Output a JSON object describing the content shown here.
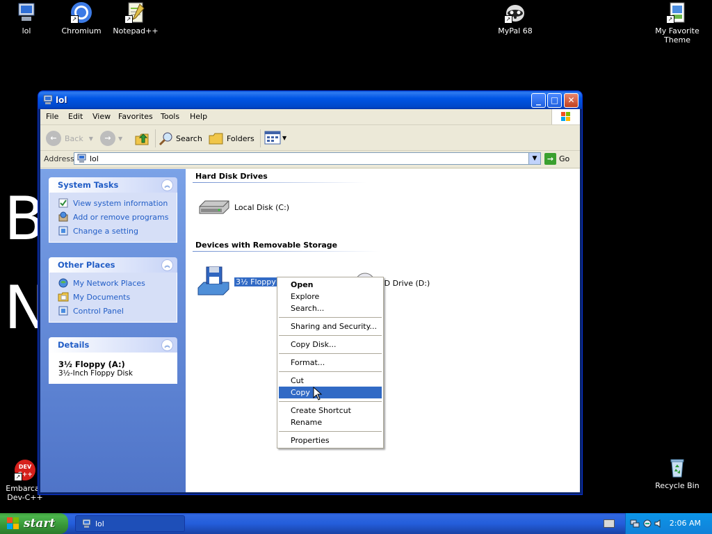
{
  "desktop": {
    "icons": [
      {
        "label": "lol"
      },
      {
        "label": "Chromium"
      },
      {
        "label": "Notepad++"
      },
      {
        "label": "MyPal 68"
      },
      {
        "label": "My Favorite Theme"
      },
      {
        "label": "Embarcad Dev-C++"
      },
      {
        "label": "Recycle Bin"
      }
    ],
    "background_letters": [
      "B",
      "N"
    ]
  },
  "window": {
    "title": "lol",
    "controls": {
      "minimize": "_",
      "maximize": "□",
      "close": "✕"
    },
    "menu": [
      "File",
      "Edit",
      "View",
      "Favorites",
      "Tools",
      "Help"
    ],
    "toolbar": {
      "back": "Back",
      "search": "Search",
      "folders": "Folders"
    },
    "address": {
      "label": "Address",
      "value": "lol",
      "go": "Go"
    }
  },
  "left_pane": {
    "system_tasks": {
      "title": "System Tasks",
      "items": [
        "View system information",
        "Add or remove programs",
        "Change a setting"
      ]
    },
    "other_places": {
      "title": "Other Places",
      "items": [
        "My Network Places",
        "My Documents",
        "Control Panel"
      ]
    },
    "details": {
      "title": "Details",
      "name": "3½ Floppy (A:)",
      "description": "3½-Inch Floppy Disk"
    }
  },
  "content": {
    "groups": [
      {
        "title": "Hard Disk Drives",
        "items": [
          "Local Disk (C:)"
        ]
      },
      {
        "title": "Devices with Removable Storage",
        "items": [
          "3½ Floppy (A:)",
          "CD Drive (D:)"
        ]
      }
    ]
  },
  "context_menu": {
    "items": [
      "Open",
      "Explore",
      "Search...",
      "Sharing and Security...",
      "Copy Disk...",
      "Format...",
      "Cut",
      "Copy",
      "Create Shortcut",
      "Rename",
      "Properties"
    ],
    "highlighted": "Copy"
  },
  "taskbar": {
    "start": "start",
    "task": "lol",
    "clock": "2:06 AM"
  },
  "colors": {
    "title_blue": "#0055E5",
    "left_pane_blue": "#6B92DD",
    "selection_blue": "#316AC5",
    "start_green": "#3C9F3C"
  }
}
